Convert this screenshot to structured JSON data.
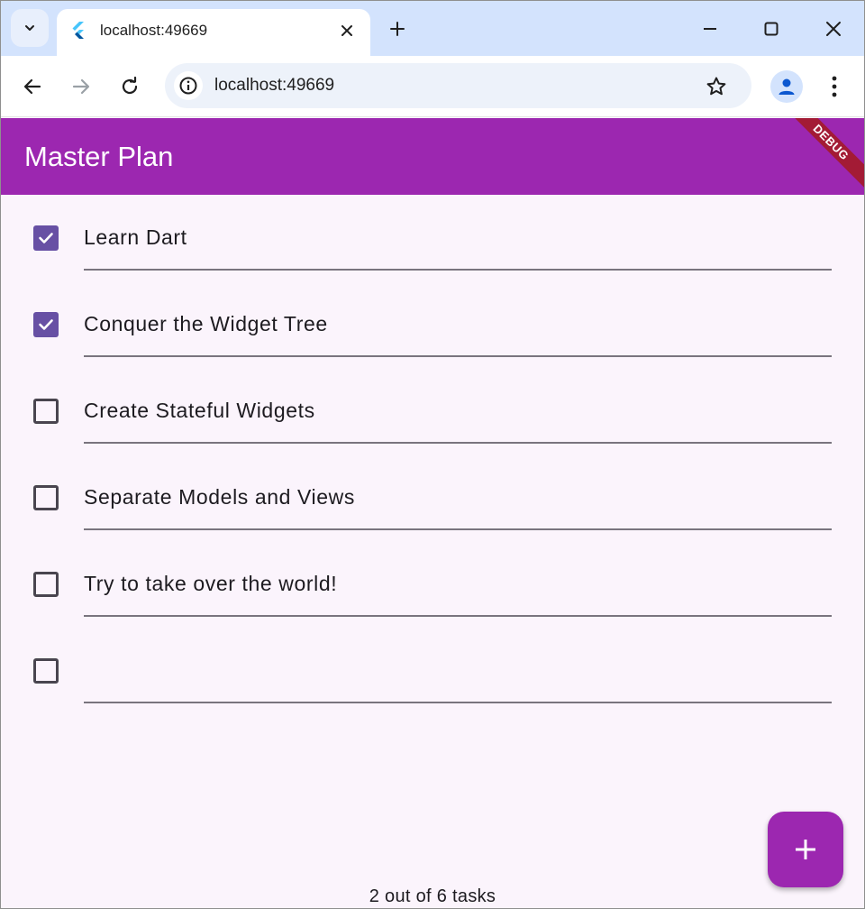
{
  "browser": {
    "tab_title": "localhost:49669",
    "url": "localhost:49669",
    "accent_color": "#d3e3fd"
  },
  "app": {
    "title": "Master Plan",
    "appbar_color": "#9c27b0",
    "debug_banner": "DEBUG",
    "checkbox_color": "#6750a4"
  },
  "tasks": [
    {
      "description": "Learn Dart",
      "complete": true
    },
    {
      "description": "Conquer the Widget Tree",
      "complete": true
    },
    {
      "description": "Create Stateful Widgets",
      "complete": false
    },
    {
      "description": "Separate Models and Views",
      "complete": false
    },
    {
      "description": "Try to take over the world!",
      "complete": false
    },
    {
      "description": "",
      "complete": false
    }
  ],
  "footer": {
    "progress_text": "2 out of 6 tasks"
  },
  "fab": {
    "icon": "add-icon"
  }
}
